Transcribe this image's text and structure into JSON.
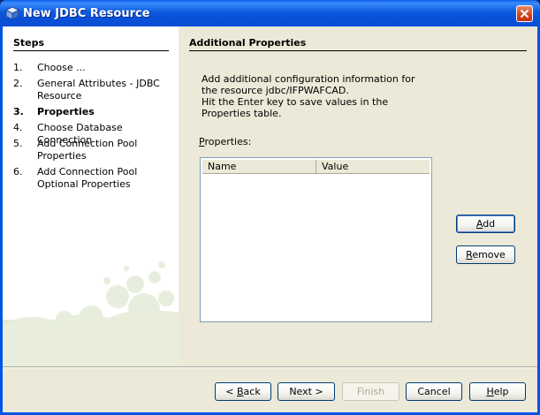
{
  "window": {
    "title": "New JDBC Resource",
    "title_icon": "cube-icon",
    "close_icon": "close-icon"
  },
  "steps": {
    "title": "Steps",
    "items": [
      {
        "num": "1.",
        "label": "Choose ..."
      },
      {
        "num": "2.",
        "label": "General Attributes - JDBC Resource"
      },
      {
        "num": "3.",
        "label": "Properties",
        "current": true
      },
      {
        "num": "4.",
        "label": "Choose Database Connection"
      },
      {
        "num": "5.",
        "label": "Add Connection Pool Properties"
      },
      {
        "num": "6.",
        "label": "Add Connection Pool Optional Properties"
      }
    ]
  },
  "content": {
    "title": "Additional Properties",
    "description_1": "Add additional configuration information for the resource jdbc/IFPWAFCAD.",
    "description_2": "Hit the Enter key to save values in the Properties table.",
    "properties_label_mnemonic": "P",
    "properties_label_rest": "roperties:",
    "table": {
      "columns": [
        "Name",
        "Value"
      ],
      "rows": []
    },
    "add_mnemonic": "A",
    "add_rest": "dd",
    "remove_mnemonic": "R",
    "remove_rest": "emove"
  },
  "footer": {
    "back_pre": "< ",
    "back_mnemonic": "B",
    "back_rest": "ack",
    "next_label": "Next >",
    "finish_label": "Finish",
    "cancel_label": "Cancel",
    "help_mnemonic": "H",
    "help_rest": "elp"
  },
  "colors": {
    "titlebar": "#0a56df",
    "client_bg": "#ece9d8",
    "steps_bg": "#ffffff",
    "table_border": "#7f9db9",
    "button_border": "#003c74"
  }
}
